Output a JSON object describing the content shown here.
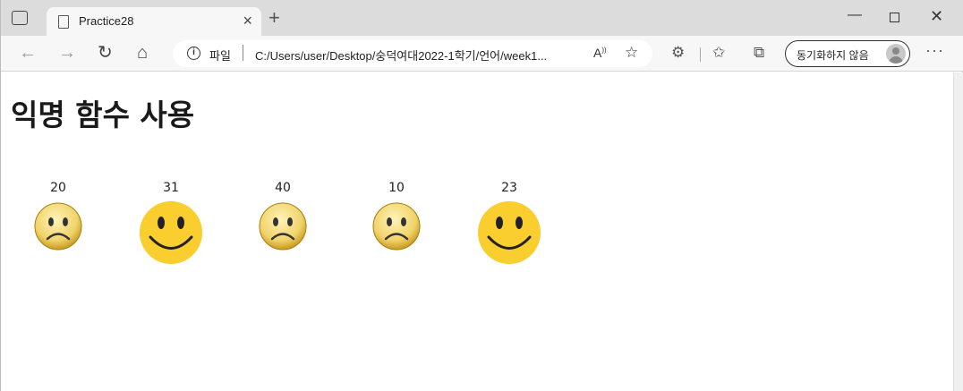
{
  "browser": {
    "tab_title": "Practice28",
    "address_scheme": "파일",
    "address_url": "C:/Users/user/Desktop/숭덕여대2022-1학기/언어/week1...",
    "profile_label": "동기화하지 않음"
  },
  "page": {
    "heading": "익명 함수 사용",
    "faces": [
      {
        "value": "20",
        "mood": "sad"
      },
      {
        "value": "31",
        "mood": "happy"
      },
      {
        "value": "40",
        "mood": "sad"
      },
      {
        "value": "10",
        "mood": "sad"
      },
      {
        "value": "23",
        "mood": "happy"
      }
    ]
  },
  "icons": {
    "tab_actions": "tab-actions-icon",
    "back": "back-arrow-icon",
    "forward": "forward-arrow-icon",
    "refresh": "refresh-icon",
    "home": "home-icon",
    "info": "info-icon",
    "read_aloud": "read-aloud-icon",
    "add_favorite": "add-favorite-icon",
    "extensions": "extensions-icon",
    "favorites": "favorites-icon",
    "collections": "collections-icon"
  },
  "colors": {
    "happy_face": "#f9ce2e",
    "sad_face": "#f0d36a"
  }
}
